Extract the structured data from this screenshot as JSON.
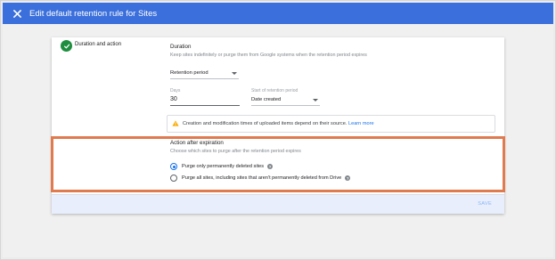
{
  "window": {
    "title": "Edit default retention rule for Sites"
  },
  "colors": {
    "topbar": "#3b6fdb",
    "accent": "#1a73e8",
    "success": "#1e8e3e",
    "warning": "#f9ab00",
    "highlight": "#e07a4f"
  },
  "icons": {
    "close": "close-icon",
    "check": "check-circle-icon",
    "warning": "warning-icon",
    "help": "help-icon",
    "dropdown": "chevron-down-icon"
  },
  "section": {
    "label": "Duration and action"
  },
  "duration": {
    "heading": "Duration",
    "description": "Keep sites indefinitely or purge them from Google systems when the retention period expires",
    "retention_select": {
      "value": "Retention period"
    },
    "days": {
      "label": "Days",
      "value": "30"
    },
    "start": {
      "label": "Start of retention period",
      "value": "Date created"
    }
  },
  "info": {
    "text": "Creation and modification times of uploaded items depend on their source.",
    "link": "Learn more"
  },
  "action": {
    "heading": "Action after expiration",
    "description": "Choose which sites to purge after the retention period expires",
    "options": [
      {
        "label": "Purge only permanently deleted sites",
        "selected": true
      },
      {
        "label": "Purge all sites, including sites that aren't permanently deleted from Drive",
        "selected": false
      }
    ]
  },
  "footer": {
    "save_label": "SAVE"
  }
}
